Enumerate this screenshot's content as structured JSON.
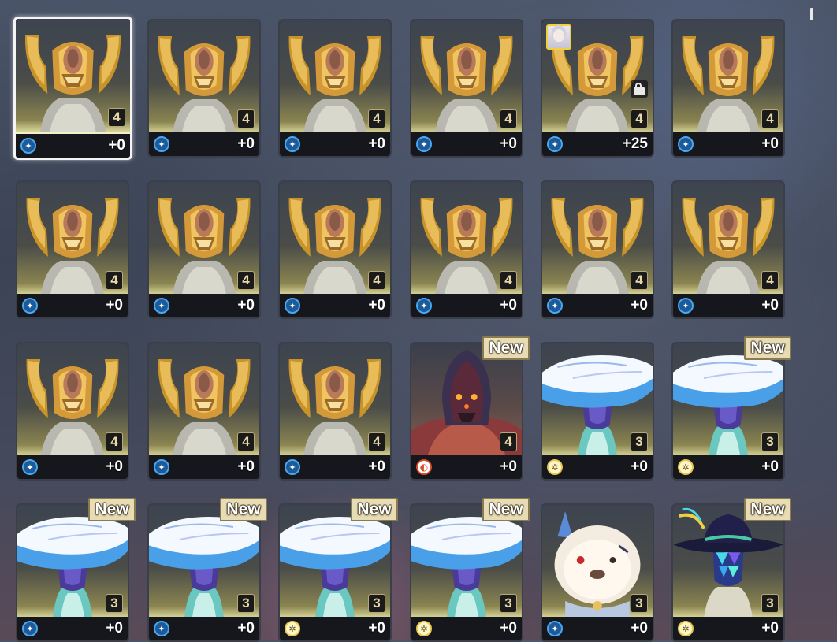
{
  "colors": {
    "element_blue": "#4aa8f0",
    "element_yellow": "#e8c650",
    "element_red": "#d84a2a",
    "new_badge": "#e8dcb4",
    "selected_border": "#f4f4f4"
  },
  "new_label": "New",
  "cards": [
    {
      "character": "golden-armor",
      "rank": "4",
      "level": "+0",
      "element": "blue",
      "selected": true
    },
    {
      "character": "golden-armor",
      "rank": "4",
      "level": "+0",
      "element": "blue"
    },
    {
      "character": "golden-armor",
      "rank": "4",
      "level": "+0",
      "element": "blue"
    },
    {
      "character": "golden-armor",
      "rank": "4",
      "level": "+0",
      "element": "blue"
    },
    {
      "character": "golden-armor",
      "rank": "4",
      "level": "+25",
      "element": "blue",
      "locked": true,
      "equipped_avatar": true
    },
    {
      "character": "golden-armor",
      "rank": "4",
      "level": "+0",
      "element": "blue"
    },
    {
      "character": "golden-armor",
      "rank": "4",
      "level": "+0",
      "element": "blue"
    },
    {
      "character": "golden-armor",
      "rank": "4",
      "level": "+0",
      "element": "blue"
    },
    {
      "character": "golden-armor",
      "rank": "4",
      "level": "+0",
      "element": "blue"
    },
    {
      "character": "golden-armor",
      "rank": "4",
      "level": "+0",
      "element": "blue"
    },
    {
      "character": "golden-armor",
      "rank": "4",
      "level": "+0",
      "element": "blue"
    },
    {
      "character": "golden-armor",
      "rank": "4",
      "level": "+0",
      "element": "blue"
    },
    {
      "character": "golden-armor",
      "rank": "4",
      "level": "+0",
      "element": "blue"
    },
    {
      "character": "golden-armor",
      "rank": "4",
      "level": "+0",
      "element": "blue"
    },
    {
      "character": "golden-armor",
      "rank": "4",
      "level": "+0",
      "element": "blue"
    },
    {
      "character": "hooded-red",
      "rank": "4",
      "level": "+0",
      "element": "red",
      "new": true
    },
    {
      "character": "white-hat",
      "rank": "3",
      "level": "+0",
      "element": "yellow"
    },
    {
      "character": "white-hat",
      "rank": "3",
      "level": "+0",
      "element": "yellow",
      "new": true
    },
    {
      "character": "white-hat",
      "rank": "3",
      "level": "+0",
      "element": "blue",
      "new": true
    },
    {
      "character": "white-hat",
      "rank": "3",
      "level": "+0",
      "element": "blue",
      "new": true
    },
    {
      "character": "white-hat",
      "rank": "3",
      "level": "+0",
      "element": "yellow",
      "new": true
    },
    {
      "character": "white-hat",
      "rank": "3",
      "level": "+0",
      "element": "yellow",
      "new": true
    },
    {
      "character": "white-bear",
      "rank": "3",
      "level": "+0",
      "element": "blue"
    },
    {
      "character": "diamond-hat",
      "rank": "3",
      "level": "+0",
      "element": "yellow",
      "new": true
    }
  ]
}
